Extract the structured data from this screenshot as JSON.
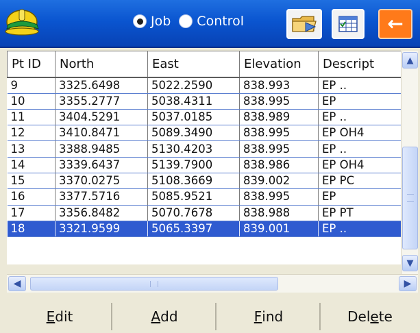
{
  "header": {
    "radio_job_label": "Job",
    "radio_control_label": "Control",
    "selected": "Job"
  },
  "table": {
    "columns": [
      "Pt ID",
      "North",
      "East",
      "Elevation",
      "Descript"
    ],
    "rows": [
      [
        "9",
        "3325.6498",
        "5022.2590",
        "838.993",
        "EP .."
      ],
      [
        "10",
        "3355.2777",
        "5038.4311",
        "838.995",
        "EP"
      ],
      [
        "11",
        "3404.5291",
        "5037.0185",
        "838.989",
        "EP .."
      ],
      [
        "12",
        "3410.8471",
        "5089.3490",
        "838.995",
        "EP OH4"
      ],
      [
        "13",
        "3388.9485",
        "5130.4203",
        "838.995",
        "EP .."
      ],
      [
        "14",
        "3339.6437",
        "5139.7900",
        "838.986",
        "EP OH4"
      ],
      [
        "15",
        "3370.0275",
        "5108.3669",
        "839.002",
        "EP PC"
      ],
      [
        "16",
        "3377.5716",
        "5085.9521",
        "838.995",
        "EP"
      ],
      [
        "17",
        "3356.8482",
        "5070.7678",
        "838.988",
        "EP PT"
      ],
      [
        "18",
        "3321.9599",
        "5065.3397",
        "839.001",
        "EP .."
      ]
    ],
    "selected_row": 9
  },
  "buttons": {
    "edit_first": "E",
    "edit_rest": "dit",
    "add_first": "A",
    "add_rest": "dd",
    "find_first": "F",
    "find_rest": "ind",
    "delete_first": "Del",
    "delete_ul": "e",
    "delete_rest": "te"
  },
  "icons": {
    "app": "hardhat-icon",
    "folder": "folder-icon",
    "table": "table-icon",
    "back": "back-arrow-icon"
  },
  "colors": {
    "titlebar": "#0a55d0",
    "selection": "#2f5bd0",
    "back_button": "#ff7a1a"
  }
}
